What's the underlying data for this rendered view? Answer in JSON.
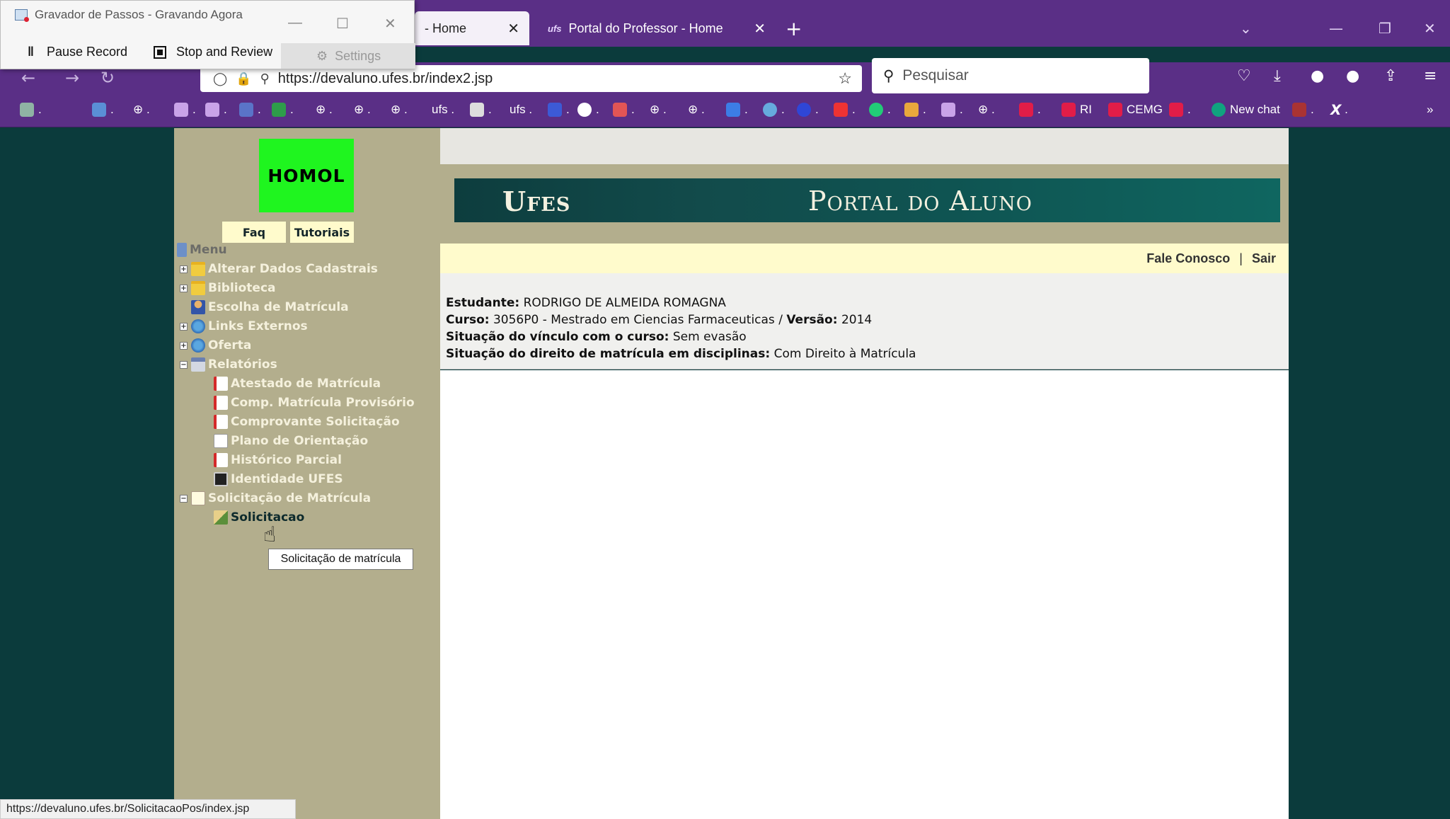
{
  "recorder": {
    "title": "Gravador de Passos - Gravando Agora",
    "pause_label": "Pause Record",
    "stop_label": "Stop and Review",
    "settings_label": "Settings"
  },
  "browser": {
    "tabs": [
      {
        "label": "- Home",
        "active": true
      },
      {
        "label": "Portal do Professor - Home",
        "active": false
      }
    ],
    "url": "https://devaluno.ufes.br/index2.jsp",
    "search_placeholder": "Pesquisar",
    "bookmarks": [
      {
        "label": "RI",
        "color": "#e11d48"
      },
      {
        "label": "CEMG",
        "color": "#e11d48"
      },
      {
        "label": "New chat",
        "color": "#10a37f"
      }
    ],
    "status_url": "https://devaluno.ufes.br/SolicitacaoPos/index.jsp"
  },
  "sidebar": {
    "homol": "HOMOL",
    "faq": "Faq",
    "tutoriais": "Tutoriais",
    "menu_label": "Menu",
    "items": [
      {
        "label": "Alterar Dados Cadastrais",
        "icon": "folder-icon"
      },
      {
        "label": "Biblioteca",
        "icon": "folder-icon"
      },
      {
        "label": "Escolha de Matrícula",
        "icon": "person-icon"
      },
      {
        "label": "Links Externos",
        "icon": "globe-icon"
      },
      {
        "label": "Oferta",
        "icon": "globe-icon"
      },
      {
        "label": "Relatórios",
        "icon": "printer-icon"
      },
      {
        "label": "Atestado de Matrícula",
        "icon": "pdf-icon"
      },
      {
        "label": "Comp. Matrícula Provisório",
        "icon": "pdf-icon"
      },
      {
        "label": "Comprovante Solicitação",
        "icon": "pdf-icon"
      },
      {
        "label": "Plano de Orientação",
        "icon": "document-icon"
      },
      {
        "label": "Histórico Parcial",
        "icon": "pdf-icon"
      },
      {
        "label": "Identidade UFES",
        "icon": "id-card-icon"
      },
      {
        "label": "Solicitação de Matrícula",
        "icon": "form-icon"
      },
      {
        "label": "Solicitacao",
        "icon": "edit-icon"
      }
    ],
    "tooltip": "Solicitação de matrícula"
  },
  "banner": {
    "ufes": "Ufes",
    "portal": "Portal do Aluno"
  },
  "linkbar": {
    "fale": "Fale Conosco",
    "sep": "|",
    "sair": "Sair"
  },
  "student": {
    "estudante_label": "Estudante:",
    "estudante": "RODRIGO DE ALMEIDA ROMAGNA",
    "curso_label": "Curso:",
    "curso": "3056P0 - Mestrado em Ciencias Farmaceuticas /",
    "versao_label": "Versão:",
    "versao": "2014",
    "vinculo_label": "Situação do vínculo com o curso:",
    "vinculo": "Sem evasão",
    "direito_label": "Situação do direito de matrícula em disciplinas:",
    "direito": "Com Direito à Matrícula"
  }
}
